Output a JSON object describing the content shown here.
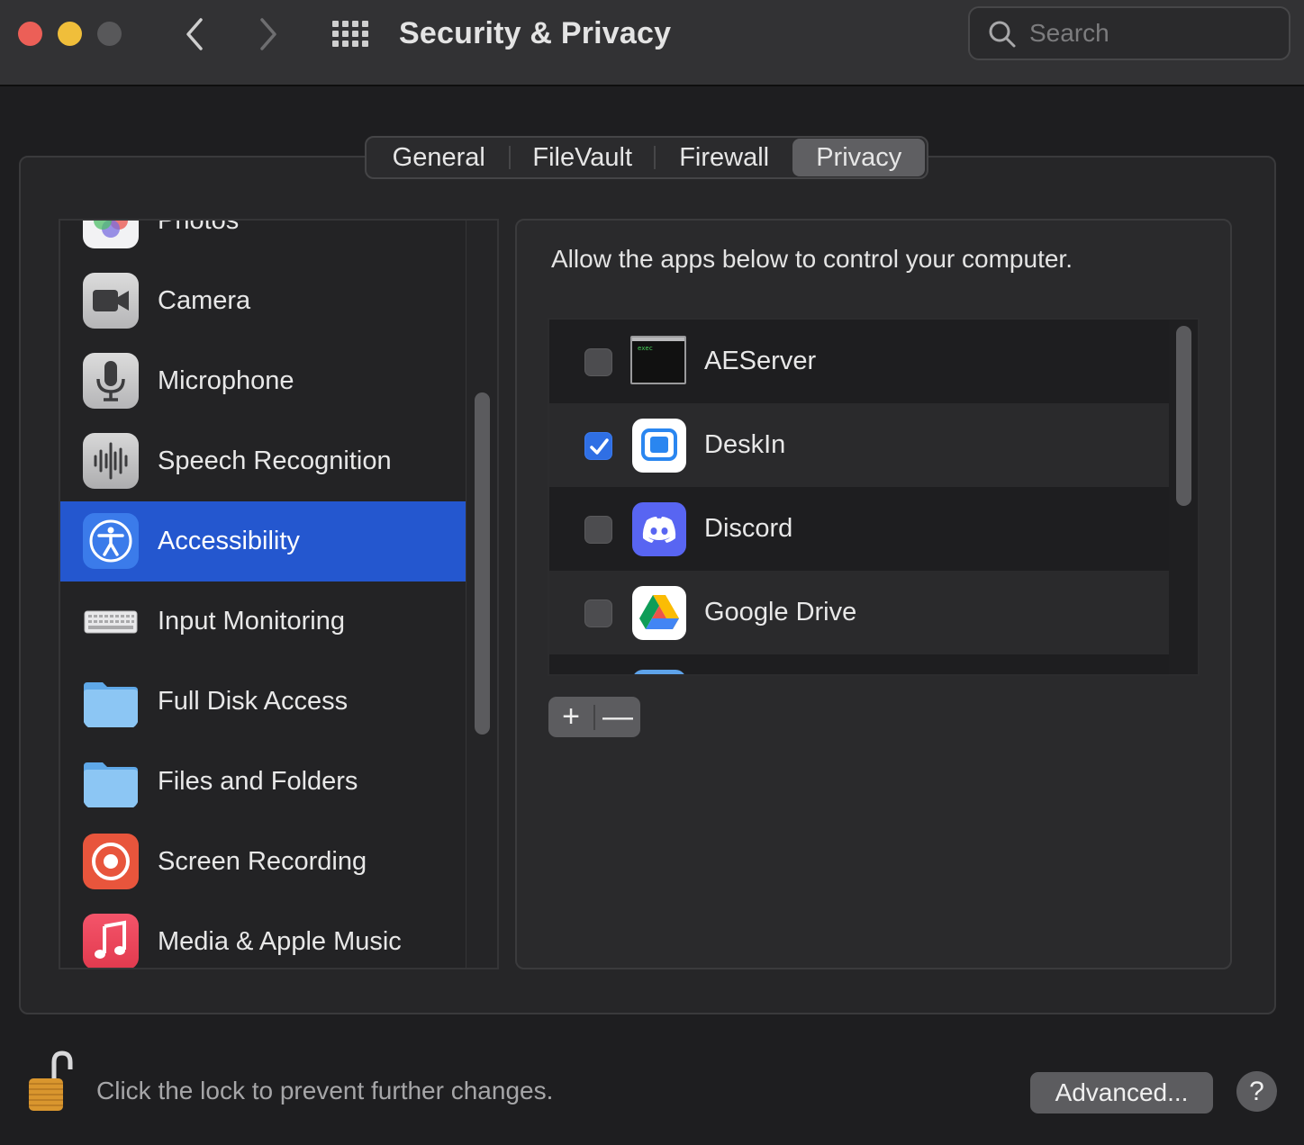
{
  "window": {
    "title": "Security & Privacy",
    "search_placeholder": "Search"
  },
  "tabs": [
    {
      "label": "General",
      "selected": false
    },
    {
      "label": "FileVault",
      "selected": false
    },
    {
      "label": "Firewall",
      "selected": false
    },
    {
      "label": "Privacy",
      "selected": true
    }
  ],
  "sidebar": {
    "items": [
      {
        "label": "Photos",
        "icon": "photos-icon"
      },
      {
        "label": "Camera",
        "icon": "camera-icon"
      },
      {
        "label": "Microphone",
        "icon": "microphone-icon"
      },
      {
        "label": "Speech Recognition",
        "icon": "speech-recognition-icon"
      },
      {
        "label": "Accessibility",
        "icon": "accessibility-icon",
        "selected": true
      },
      {
        "label": "Input Monitoring",
        "icon": "keyboard-icon"
      },
      {
        "label": "Full Disk Access",
        "icon": "folder-icon"
      },
      {
        "label": "Files and Folders",
        "icon": "folder-icon"
      },
      {
        "label": "Screen Recording",
        "icon": "screen-recording-icon"
      },
      {
        "label": "Media & Apple Music",
        "icon": "music-icon"
      }
    ]
  },
  "panel": {
    "description": "Allow the apps below to control your computer.",
    "apps": [
      {
        "name": "AEServer",
        "checked": false,
        "icon": "terminal-exec-icon"
      },
      {
        "name": "DeskIn",
        "checked": true,
        "icon": "deskin-icon"
      },
      {
        "name": "Discord",
        "checked": false,
        "icon": "discord-icon"
      },
      {
        "name": "Google Drive",
        "checked": false,
        "icon": "google-drive-icon"
      }
    ],
    "add_label": "+",
    "remove_label": "—"
  },
  "footer": {
    "lock_text": "Click the lock to prevent further changes.",
    "advanced_label": "Advanced...",
    "help_label": "?"
  },
  "colors": {
    "accent": "#2457cf",
    "checkbox_checked": "#2f6fe4",
    "close": "#ec5f57",
    "minimize": "#f0be3a"
  }
}
